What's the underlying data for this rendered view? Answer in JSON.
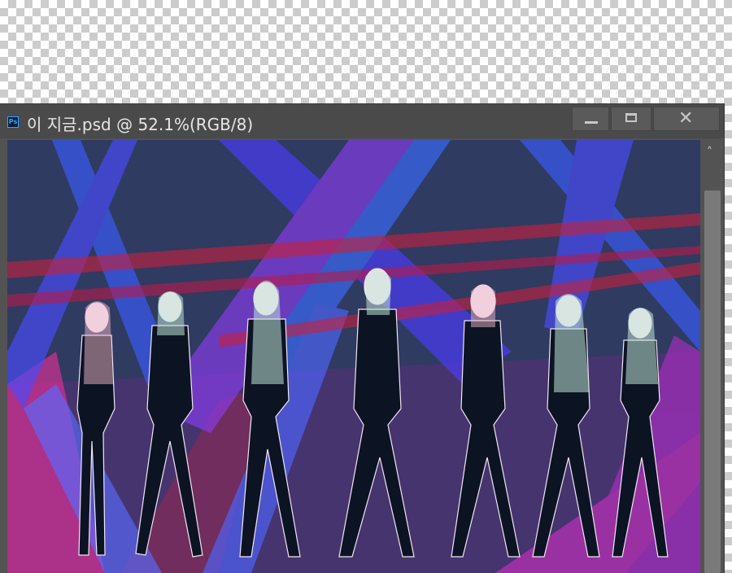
{
  "document": {
    "title": "이 지금.psd @ 52.1%(RGB/8)",
    "app_icon_label": "Ps",
    "icon": "photoshop-icon"
  },
  "window_controls": {
    "minimize_icon": "minimize-icon",
    "maximize_icon": "maximize-icon",
    "close_icon": "close-icon",
    "close_glyph": "✕"
  },
  "scrollbar": {
    "up_glyph": "˄"
  },
  "colors": {
    "canvas_background": "#2f3b60",
    "beam_blue": "#3b5cff",
    "beam_purple": "#8a3cf0",
    "beam_pink": "#ff2fa0",
    "beam_red": "#c8203c",
    "window_chrome": "#4a4a4a"
  }
}
